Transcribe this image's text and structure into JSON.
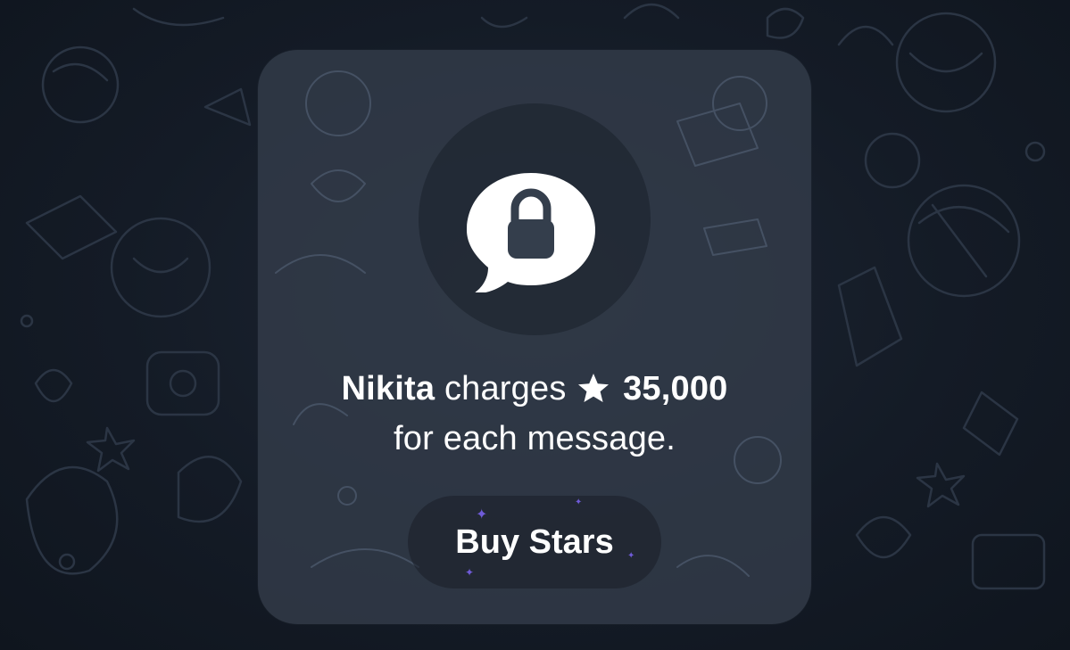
{
  "dialog": {
    "user_name": "Nikita",
    "charges_text": "charges",
    "star_amount": "35,000",
    "line2": "for each message.",
    "buy_button_label": "Buy Stars"
  },
  "icons": {
    "main_icon": "lock-message-bubble-icon",
    "currency_icon": "star-icon"
  },
  "colors": {
    "background": "#141b26",
    "card": "#343e4c",
    "text": "#ffffff",
    "sparkle": "#6f5bd8"
  }
}
